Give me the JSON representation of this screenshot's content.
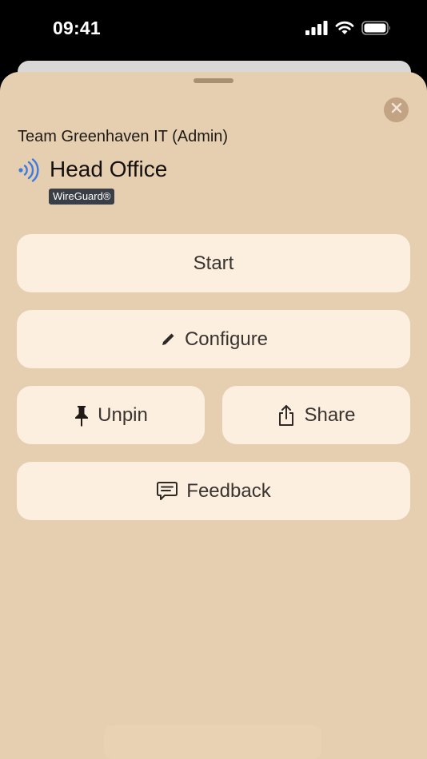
{
  "status_bar": {
    "time": "09:41",
    "icons": [
      "signal-icon",
      "wifi-icon",
      "battery-icon"
    ]
  },
  "sheet": {
    "team": "Team Greenhaven IT (Admin)",
    "title": "Head Office",
    "protocol_badge": "WireGuard®",
    "close_icon": "close-icon",
    "accent_color": "#3d7be3"
  },
  "actions": {
    "start": {
      "label": "Start"
    },
    "configure": {
      "label": "Configure",
      "icon": "pencil-icon"
    },
    "unpin": {
      "label": "Unpin",
      "icon": "pin-icon"
    },
    "share": {
      "label": "Share",
      "icon": "share-icon"
    },
    "feedback": {
      "label": "Feedback",
      "icon": "feedback-icon"
    }
  },
  "colors": {
    "sheet_background": "#e6cfb0",
    "button_background": "#fcefdf",
    "badge_background": "#3a3e46"
  }
}
